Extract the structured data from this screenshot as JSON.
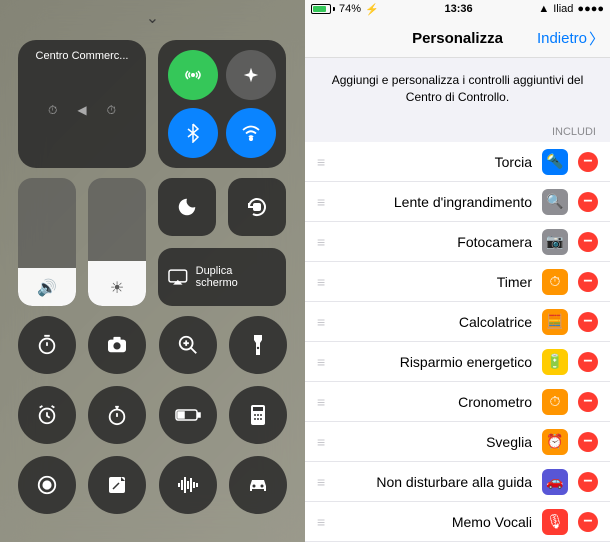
{
  "status_bar": {
    "carrier": "Iliad",
    "time": "13:36",
    "battery_pct": "74%"
  },
  "control_center": {
    "music_title": "Centro Commerc...",
    "mirroring_label": "Duplica schermo",
    "brightness_fill_pct": 35,
    "volume_fill_pct": 30
  },
  "nav": {
    "back_label": "Indietro",
    "title": "Personalizza"
  },
  "description": "Aggiungi e personalizza i controlli aggiuntivi del Centro di Controllo.",
  "section_header": "INCLUDI",
  "items": [
    {
      "label": "Torcia",
      "icon_color": "ic-blue",
      "glyph": "🔦"
    },
    {
      "label": "Lente d'ingrandimento",
      "icon_color": "ic-gray",
      "glyph": "🔍"
    },
    {
      "label": "Fotocamera",
      "icon_color": "ic-gray",
      "glyph": "📷"
    },
    {
      "label": "Timer",
      "icon_color": "ic-orange",
      "glyph": "⏱"
    },
    {
      "label": "Calcolatrice",
      "icon_color": "ic-orange",
      "glyph": "🧮"
    },
    {
      "label": "Risparmio energetico",
      "icon_color": "ic-yellow",
      "glyph": "🔋"
    },
    {
      "label": "Cronometro",
      "icon_color": "ic-orange",
      "glyph": "⏱"
    },
    {
      "label": "Sveglia",
      "icon_color": "ic-orange",
      "glyph": "⏰"
    },
    {
      "label": "Non disturbare alla guida",
      "icon_color": "ic-purple",
      "glyph": "🚗"
    },
    {
      "label": "Memo Vocali",
      "icon_color": "ic-red",
      "glyph": "🎙"
    }
  ]
}
